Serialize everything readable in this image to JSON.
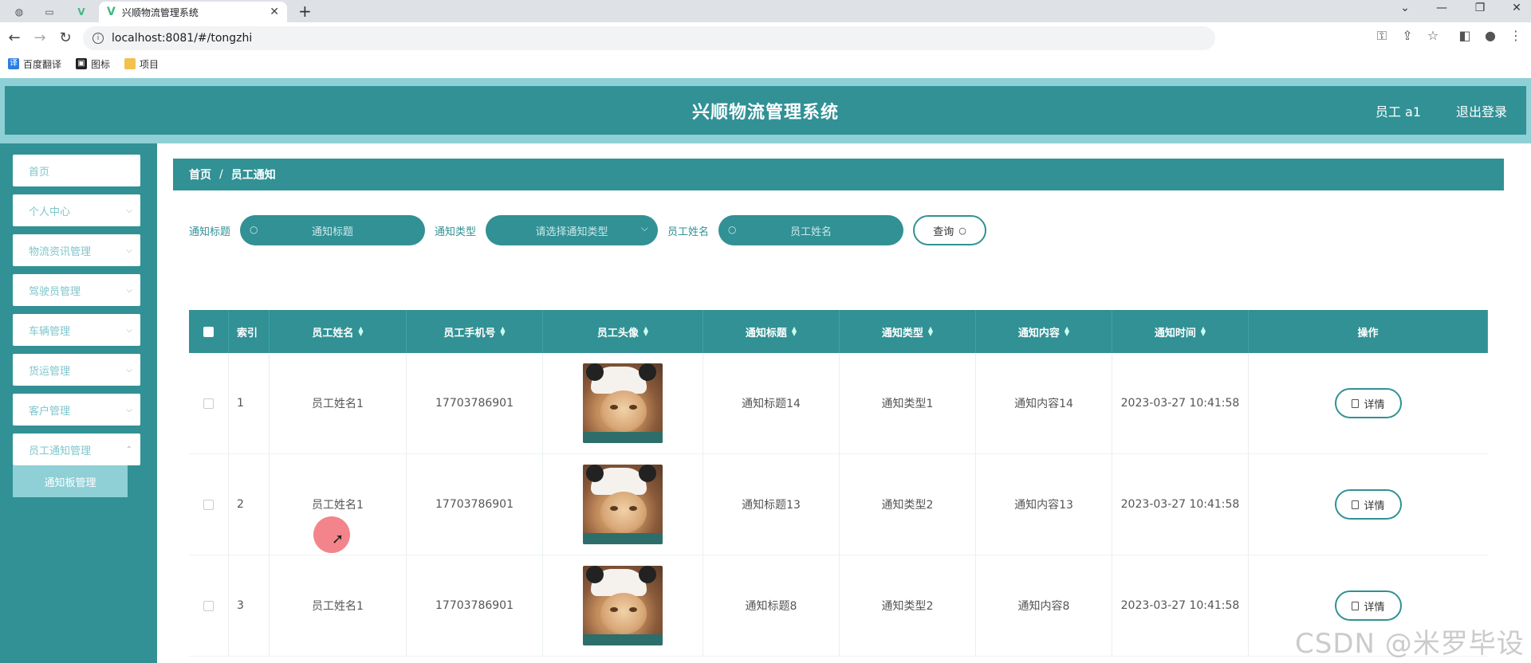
{
  "browser": {
    "active_tab_title": "兴顺物流管理系统",
    "url": "localhost:8081/#/tongzhi",
    "bookmarks": [
      {
        "label": "百度翻译",
        "icon": "translate-icon",
        "color": "#2a7de1"
      },
      {
        "label": "图标",
        "icon": "image-icon",
        "color": "#222222"
      },
      {
        "label": "项目",
        "icon": "folder-icon",
        "color": "#f2c14e"
      }
    ]
  },
  "header": {
    "title": "兴顺物流管理系统",
    "user": "员工 a1",
    "logout": "退出登录"
  },
  "sidebar": {
    "items": [
      {
        "label": "首页",
        "has_children": false
      },
      {
        "label": "个人中心",
        "has_children": true
      },
      {
        "label": "物流资讯管理",
        "has_children": true
      },
      {
        "label": "驾驶员管理",
        "has_children": true
      },
      {
        "label": "车辆管理",
        "has_children": true
      },
      {
        "label": "货运管理",
        "has_children": true
      },
      {
        "label": "客户管理",
        "has_children": true
      },
      {
        "label": "员工通知管理",
        "has_children": true
      }
    ],
    "submenu": {
      "label": "通知板管理"
    }
  },
  "breadcrumb": {
    "home": "首页",
    "separator": "/",
    "current": "员工通知"
  },
  "filters": {
    "title_label": "通知标题",
    "title_placeholder": "通知标题",
    "type_label": "通知类型",
    "type_placeholder": "请选择通知类型",
    "name_label": "员工姓名",
    "name_placeholder": "员工姓名",
    "query_button": "查询"
  },
  "table": {
    "columns": [
      "索引",
      "员工姓名",
      "员工手机号",
      "员工头像",
      "通知标题",
      "通知类型",
      "通知内容",
      "通知时间",
      "操作"
    ],
    "rows": [
      {
        "index": "1",
        "name": "员工姓名1",
        "phone": "17703786901",
        "title": "通知标题14",
        "type": "通知类型1",
        "content": "通知内容14",
        "time": "2023-03-27 10:41:58",
        "action": "详情"
      },
      {
        "index": "2",
        "name": "员工姓名1",
        "phone": "17703786901",
        "title": "通知标题13",
        "type": "通知类型2",
        "content": "通知内容13",
        "time": "2023-03-27 10:41:58",
        "action": "详情"
      },
      {
        "index": "3",
        "name": "员工姓名1",
        "phone": "17703786901",
        "title": "通知标题8",
        "type": "通知类型2",
        "content": "通知内容8",
        "time": "2023-03-27 10:41:58",
        "action": "详情"
      }
    ]
  },
  "watermark": "CSDN @米罗毕设",
  "colors": {
    "primary": "#319195",
    "light": "#8fcfd6"
  }
}
